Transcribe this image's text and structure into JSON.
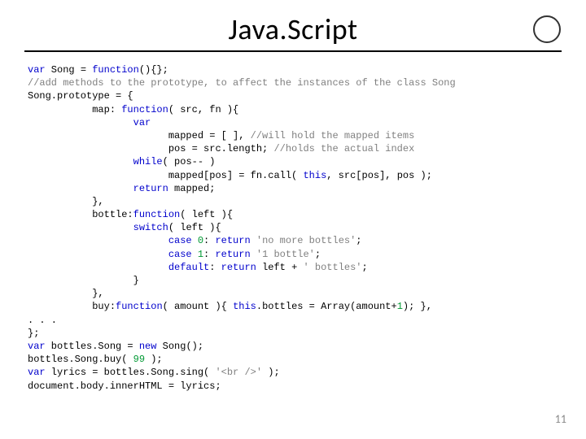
{
  "title": "Java.Script",
  "page_number": "11",
  "code": {
    "l01a": "var",
    "l01b": " Song = ",
    "l01c": "function",
    "l01d": "(){};",
    "l02": "//add methods to the prototype, to affect the instances of the class Song",
    "l03": "Song.prototype = {",
    "l04a": "           map: ",
    "l04b": "function",
    "l04c": "( src, fn ){",
    "l05": "                  var",
    "l06a": "                        mapped = [ ], ",
    "l06b": "//will hold the mapped items",
    "l07a": "                        pos = src.length; ",
    "l07b": "//holds the actual index",
    "l08a": "                  ",
    "l08b": "while",
    "l08c": "( pos-- )",
    "l09a": "                        mapped[pos] = fn.call( ",
    "l09b": "this",
    "l09c": ", src[pos], pos );",
    "l10a": "                  ",
    "l10b": "return",
    "l10c": " mapped;",
    "l11": "           },",
    "l12a": "           bottle:",
    "l12b": "function",
    "l12c": "( left ){",
    "l13a": "                  ",
    "l13b": "switch",
    "l13c": "( left ){",
    "l14a": "                        ",
    "l14b": "case",
    "l14c": " ",
    "l14d": "0",
    "l14e": ": ",
    "l14f": "return",
    "l14g": " ",
    "l14h": "'no more bottles'",
    "l14i": ";",
    "l15a": "                        ",
    "l15b": "case",
    "l15c": " ",
    "l15d": "1",
    "l15e": ": ",
    "l15f": "return",
    "l15g": " ",
    "l15h": "'1 bottle'",
    "l15i": ";",
    "l16a": "                        ",
    "l16b": "default",
    "l16c": ": ",
    "l16d": "return",
    "l16e": " left + ",
    "l16f": "' bottles'",
    "l16g": ";",
    "l17": "                  }",
    "l18": "           },",
    "l19a": "           buy:",
    "l19b": "function",
    "l19c": "( amount ){ ",
    "l19d": "this",
    "l19e": ".bottles = Array(amount+",
    "l19f": "1",
    "l19g": "); },",
    "l20": ". . .",
    "l21": "};",
    "l22a": "var",
    "l22b": " bottles.Song = ",
    "l22c": "new",
    "l22d": " Song();",
    "l23a": "bottles.Song.buy( ",
    "l23b": "99",
    "l23c": " );",
    "l24a": "var",
    "l24b": " lyrics = bottles.Song.sing( ",
    "l24c": "'<br />'",
    "l24d": " );",
    "l25": "document.body.innerHTML = lyrics;"
  }
}
